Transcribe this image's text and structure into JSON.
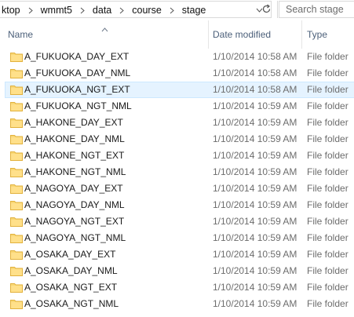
{
  "address": {
    "crumbs": [
      "ktop",
      "wmmt5",
      "data",
      "course",
      "stage"
    ]
  },
  "search": {
    "placeholder": "Search stage"
  },
  "columns": {
    "name": "Name",
    "date": "Date modified",
    "type": "Type"
  },
  "colors": {
    "selected_bg": "#e5f3ff",
    "selected_border": "#cce8ff",
    "folder": "#f8d775"
  },
  "rows": [
    {
      "name": "A_FUKUOKA_DAY_EXT",
      "date": "1/10/2014 10:58 AM",
      "type": "File folder"
    },
    {
      "name": "A_FUKUOKA_DAY_NML",
      "date": "1/10/2014 10:58 AM",
      "type": "File folder"
    },
    {
      "name": "A_FUKUOKA_NGT_EXT",
      "date": "1/10/2014 10:58 AM",
      "type": "File folder"
    },
    {
      "name": "A_FUKUOKA_NGT_NML",
      "date": "1/10/2014 10:59 AM",
      "type": "File folder"
    },
    {
      "name": "A_HAKONE_DAY_EXT",
      "date": "1/10/2014 10:59 AM",
      "type": "File folder"
    },
    {
      "name": "A_HAKONE_DAY_NML",
      "date": "1/10/2014 10:59 AM",
      "type": "File folder"
    },
    {
      "name": "A_HAKONE_NGT_EXT",
      "date": "1/10/2014 10:59 AM",
      "type": "File folder"
    },
    {
      "name": "A_HAKONE_NGT_NML",
      "date": "1/10/2014 10:59 AM",
      "type": "File folder"
    },
    {
      "name": "A_NAGOYA_DAY_EXT",
      "date": "1/10/2014 10:59 AM",
      "type": "File folder"
    },
    {
      "name": "A_NAGOYA_DAY_NML",
      "date": "1/10/2014 10:59 AM",
      "type": "File folder"
    },
    {
      "name": "A_NAGOYA_NGT_EXT",
      "date": "1/10/2014 10:59 AM",
      "type": "File folder"
    },
    {
      "name": "A_NAGOYA_NGT_NML",
      "date": "1/10/2014 10:59 AM",
      "type": "File folder"
    },
    {
      "name": "A_OSAKA_DAY_EXT",
      "date": "1/10/2014 10:59 AM",
      "type": "File folder"
    },
    {
      "name": "A_OSAKA_DAY_NML",
      "date": "1/10/2014 10:59 AM",
      "type": "File folder"
    },
    {
      "name": "A_OSAKA_NGT_EXT",
      "date": "1/10/2014 10:59 AM",
      "type": "File folder"
    },
    {
      "name": "A_OSAKA_NGT_NML",
      "date": "1/10/2014 10:59 AM",
      "type": "File folder"
    }
  ],
  "selected_index": 2
}
